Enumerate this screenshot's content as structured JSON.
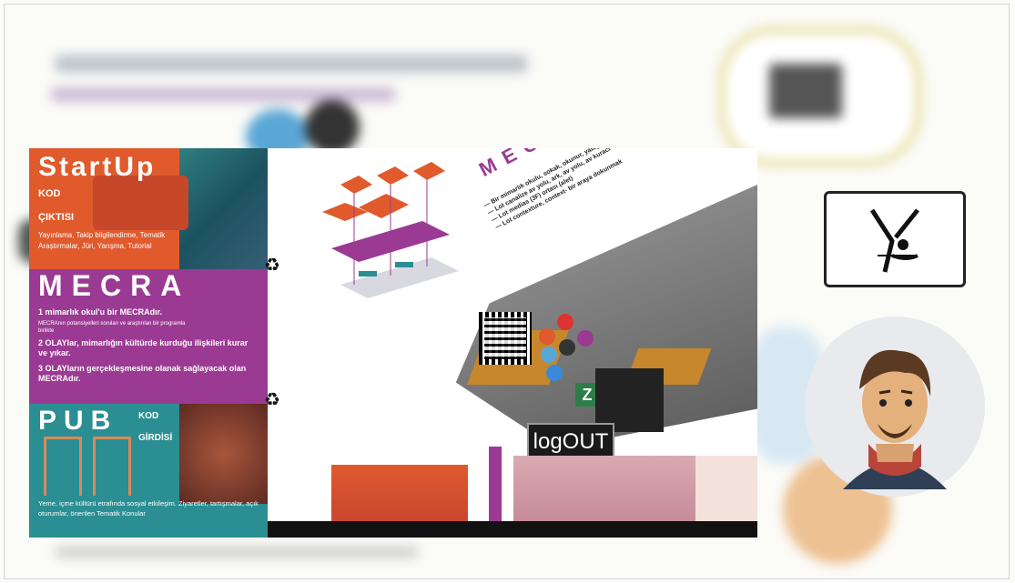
{
  "poster": {
    "startup": {
      "title": "StartUp",
      "kod": "KOD",
      "cikti": "ÇIKTISI",
      "desc": "Yayınlama, Takip bilgilendirme, Tematik Araştırmalar, Jüri, Yarışma, Tutorial"
    },
    "mecra_left": {
      "title": "MECRA",
      "line1": "1 mimarlık okul'u bir MECRAdır.",
      "small1": "MECRAnın potansiyelleri sorulan ve araştırılan bir programla birlikte",
      "line2": "2 OLAYlar, mimarlığın kültürde kurduğu ilişkileri kurar ve yıkar.",
      "line3": "3 OLAYların gerçekleşmesine olanak sağlayacak olan MECRAdır."
    },
    "pub": {
      "title": "PUB",
      "kod": "KOD",
      "girdi": "GİRDİSİ",
      "desc": "Yeme, içme kültürü etrafında sosyal etkileşim. Ziyaretler, tartışmalar, açık oturumlar, önerilen Tematik Konular"
    },
    "mecra_right": {
      "title": "MECRA",
      "lines": [
        "— Bir mimarlık okulu, sokak, okunur, yatağı.",
        "— Lot canalize av yolu, ark, av yolu, av kuracı",
        "— Lot medias (3F) ortası (alet)",
        "— Lot contexture, context- bir araya dokunmak"
      ]
    },
    "logout": "logOUT",
    "z_label": "Z"
  },
  "colors": {
    "orange": "#e05a2c",
    "purple": "#9b3a93",
    "teal": "#2a8e92",
    "ochre": "#c7872c"
  }
}
